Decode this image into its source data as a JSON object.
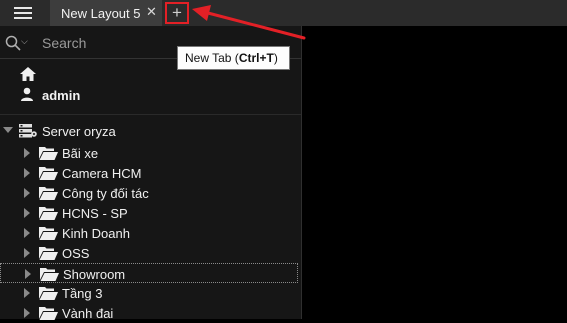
{
  "menu": {
    "icon": "hamburger-menu-icon"
  },
  "tabs": [
    {
      "label": "New Layout 5",
      "close": "✕"
    }
  ],
  "new_tab": {
    "symbol": "+",
    "tooltip_prefix": "New Tab (",
    "tooltip_shortcut": "Ctrl+T",
    "tooltip_suffix": ")"
  },
  "tab_dropdown": {
    "symbol": "⌄"
  },
  "search": {
    "placeholder": "Search"
  },
  "user": {
    "name": "admin"
  },
  "server": {
    "name": "Server oryza"
  },
  "folders": [
    {
      "label": "Bãi xe"
    },
    {
      "label": "Camera HCM"
    },
    {
      "label": "Công ty đối tác"
    },
    {
      "label": "HCNS - SP"
    },
    {
      "label": "Kinh Doanh"
    },
    {
      "label": "OSS"
    },
    {
      "label": "Showroom",
      "selected": true
    },
    {
      "label": "Tầng 3"
    },
    {
      "label": "Vành đai"
    }
  ],
  "colors": {
    "annotation": "#e32026",
    "background": "#000000",
    "sidebar": "#161616",
    "tab_bar": "#2b2b2b"
  }
}
